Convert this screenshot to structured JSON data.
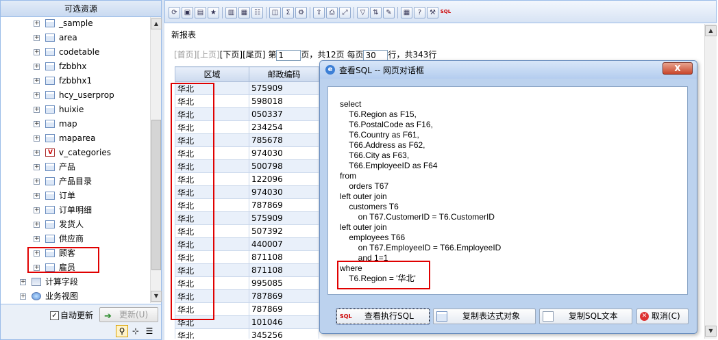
{
  "left_panel": {
    "title": "可选资源",
    "tree": [
      {
        "label": "_sample",
        "icon": "table-icon",
        "expand": "+",
        "level": 2
      },
      {
        "label": "area",
        "icon": "table-icon",
        "expand": "+",
        "level": 2
      },
      {
        "label": "codetable",
        "icon": "table-icon",
        "expand": "+",
        "level": 2
      },
      {
        "label": "fzbbhx",
        "icon": "table-icon",
        "expand": "+",
        "level": 2
      },
      {
        "label": "fzbbhx1",
        "icon": "table-icon",
        "expand": "+",
        "level": 2
      },
      {
        "label": "hcy_userprop",
        "icon": "table-icon",
        "expand": "+",
        "level": 2
      },
      {
        "label": "huixie",
        "icon": "table-icon",
        "expand": "+",
        "level": 2
      },
      {
        "label": "map",
        "icon": "table-icon",
        "expand": "+",
        "level": 2
      },
      {
        "label": "maparea",
        "icon": "table-icon",
        "expand": "+",
        "level": 2
      },
      {
        "label": "v_categories",
        "icon": "view-icon",
        "expand": "+",
        "level": 2
      },
      {
        "label": "产品",
        "icon": "table-icon",
        "expand": "+",
        "level": 2
      },
      {
        "label": "产品目录",
        "icon": "table-icon",
        "expand": "+",
        "level": 2
      },
      {
        "label": "订单",
        "icon": "table-icon",
        "expand": "+",
        "level": 2
      },
      {
        "label": "订单明细",
        "icon": "table-icon",
        "expand": "+",
        "level": 2
      },
      {
        "label": "发货人",
        "icon": "table-icon",
        "expand": "+",
        "level": 2
      },
      {
        "label": "供应商",
        "icon": "table-icon",
        "expand": "+",
        "level": 2
      },
      {
        "label": "顾客",
        "icon": "table-icon",
        "expand": "+",
        "level": 2
      },
      {
        "label": "雇员",
        "icon": "table-icon",
        "expand": "+",
        "level": 2
      },
      {
        "label": "计算字段",
        "icon": "folder-icon",
        "expand": "+",
        "level": 1
      },
      {
        "label": "业务视图",
        "icon": "globe-icon",
        "expand": "+",
        "level": 1
      }
    ],
    "auto_update_label": "自动更新",
    "auto_update_checked": "✓",
    "refresh_label": "更新(U)"
  },
  "toolbar": {
    "buttons": [
      "refresh-icon",
      "save-icon",
      "save-as-icon",
      "favorite-icon",
      "|",
      "chart-icon",
      "layout-icon",
      "tree-icon",
      "|",
      "preview-icon",
      "sum-icon",
      "parameter-icon",
      "|",
      "export-icon",
      "print-icon",
      "fit-icon",
      "|",
      "filter-icon",
      "sort-icon",
      "properties-icon",
      "|",
      "table-icon",
      "help-icon",
      "settings-icon",
      "sql-icon"
    ],
    "sql_label": "SQL"
  },
  "report": {
    "title": "新报表",
    "pager": {
      "first": "[首页]",
      "prev": "[上页]",
      "next": "[下页]",
      "last": "[尾页]",
      "page_prefix": "第",
      "page_value": "1",
      "page_suffix": "页，共12页",
      "per_page_prefix": "每页",
      "per_page_value": "30",
      "per_page_suffix": "行，共343行"
    },
    "columns": [
      "区域",
      "邮政编码"
    ],
    "rows": [
      [
        "华北",
        "575909"
      ],
      [
        "华北",
        "598018"
      ],
      [
        "华北",
        "050337"
      ],
      [
        "华北",
        "234254"
      ],
      [
        "华北",
        "785678"
      ],
      [
        "华北",
        "974030"
      ],
      [
        "华北",
        "500798"
      ],
      [
        "华北",
        "122096"
      ],
      [
        "华北",
        "974030"
      ],
      [
        "华北",
        "787869"
      ],
      [
        "华北",
        "575909"
      ],
      [
        "华北",
        "507392"
      ],
      [
        "华北",
        "440007"
      ],
      [
        "华北",
        "871108"
      ],
      [
        "华北",
        "871108"
      ],
      [
        "华北",
        "995085"
      ],
      [
        "华北",
        "787869"
      ],
      [
        "华北",
        "787869"
      ],
      [
        "华北",
        "101046"
      ],
      [
        "华北",
        "345256"
      ]
    ]
  },
  "dialog": {
    "title": "查看SQL -- 网页对话框",
    "close": "X",
    "sql_lines": [
      "select",
      "    T6.Region as F15,",
      "    T6.PostalCode as F16,",
      "    T6.Country as F61,",
      "    T66.Address as F62,",
      "    T66.City as F63,",
      "    T66.EmployeeID as F64",
      "from",
      "    orders T67",
      "left outer join",
      "    customers T6",
      "        on T67.CustomerID = T6.CustomerID",
      "left outer join",
      "    employees T66",
      "        on T67.EmployeeID = T66.EmployeeID",
      "        and 1=1",
      "where",
      "    T6.Region = '华北'"
    ],
    "buttons": {
      "view_exec_sql": "查看执行SQL",
      "copy_expr": "复制表达式对象",
      "copy_sql": "复制SQL文本",
      "cancel": "取消(C)"
    }
  }
}
